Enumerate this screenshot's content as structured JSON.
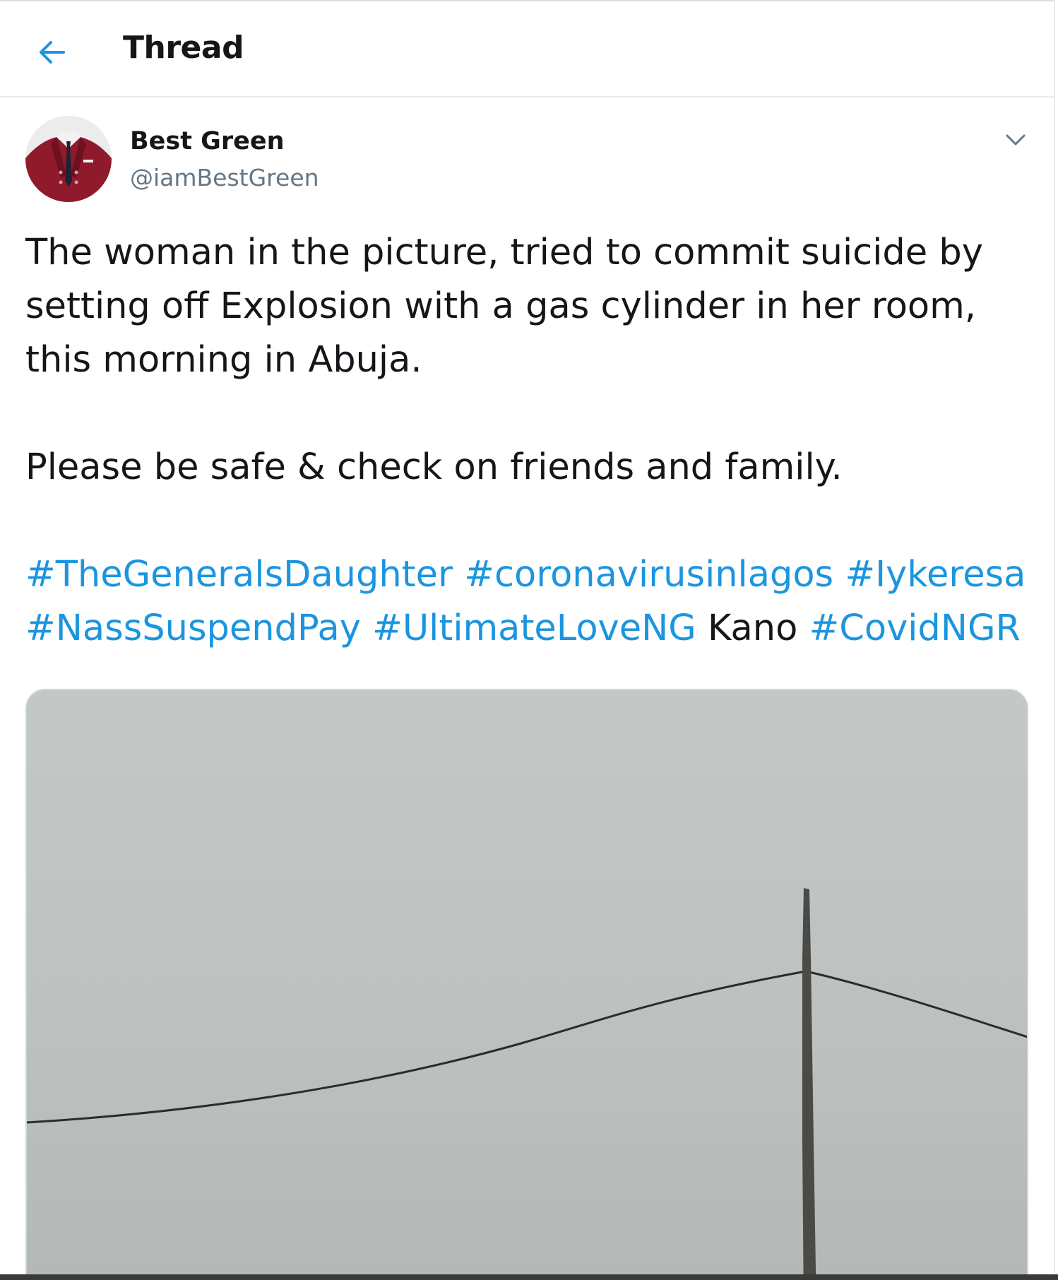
{
  "header": {
    "back_icon": "arrow-left-icon",
    "title": "Thread"
  },
  "tweet": {
    "author": {
      "name": "Best Green",
      "handle": "@iamBestGreen",
      "avatar_icon": "red-suit-avatar"
    },
    "caret_icon": "chevron-down-icon",
    "paragraphs": [
      "The woman in the picture, tried to commit suicide by setting off Explosion with a gas cylinder in her room, this morning in Abuja.",
      "Please be safe & check on friends and family."
    ],
    "hashtags": {
      "tag1": "#TheGeneralsDaughter",
      "tag2": "#coronavirusinlagos",
      "tag3": "#Iykeresa",
      "tag4": "#NassSuspendPay",
      "tag5": "#UltimateLoveNG",
      "plain_word": "Kano",
      "tag6": "#CovidNGR"
    },
    "media": {
      "description_icon": "sky-with-pole-and-wire-photo"
    }
  },
  "colors": {
    "accent": "#1b95e0",
    "text": "#14171a",
    "secondary": "#657786",
    "border": "#e6ecf0"
  }
}
